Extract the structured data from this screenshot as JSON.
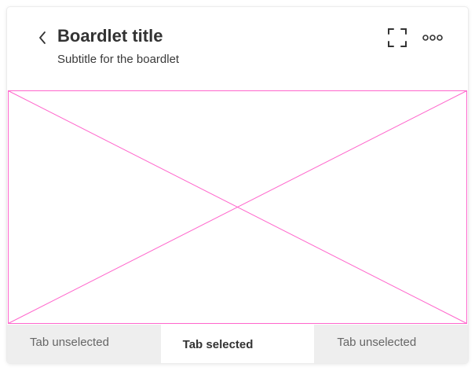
{
  "boardlet": {
    "title": "Boardlet title",
    "subtitle": "Subtitle for the boardlet",
    "back_icon": "chevron-left-icon",
    "fullscreen_icon": "fullscreen-icon",
    "more_icon": "more-horizontal-icon"
  },
  "placeholder": {
    "type": "image-placeholder",
    "stroke_color": "#ff66cc"
  },
  "tabs": [
    {
      "label": "Tab unselected",
      "selected": false
    },
    {
      "label": "Tab selected",
      "selected": true
    },
    {
      "label": "Tab unselected",
      "selected": false
    }
  ],
  "colors": {
    "title": "#333333",
    "tab_unselected_bg": "#eeeeee",
    "tab_selected_bg": "#ffffff"
  }
}
